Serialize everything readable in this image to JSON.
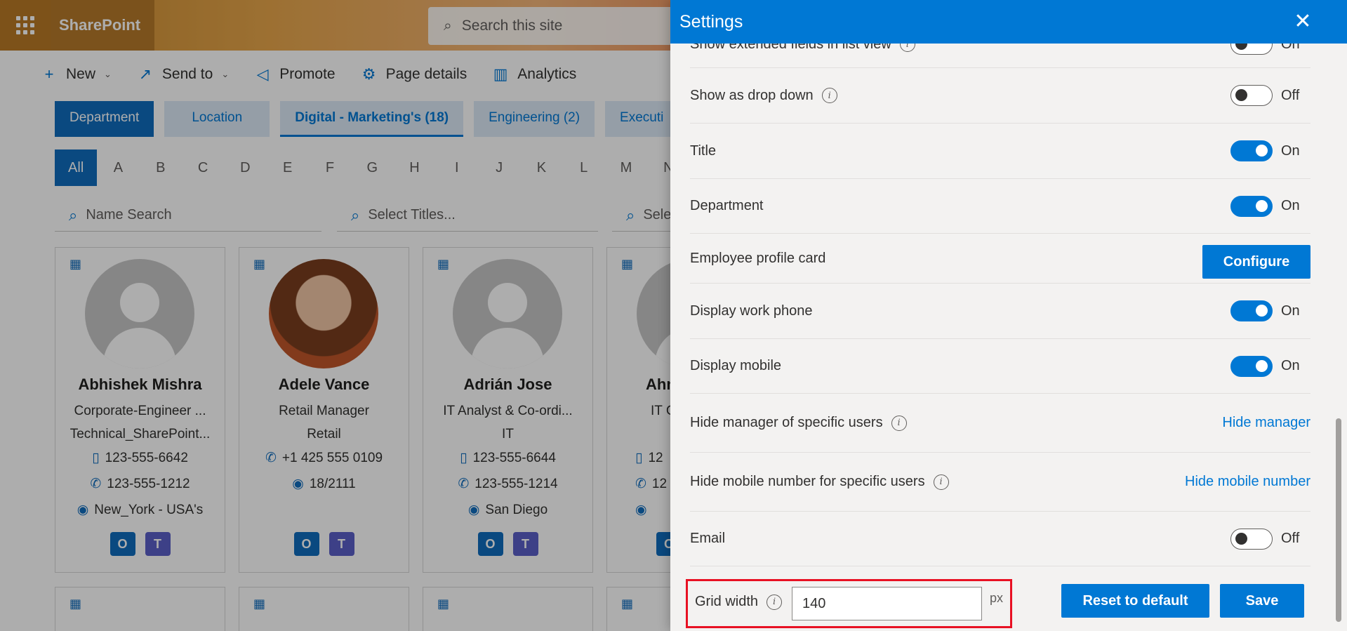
{
  "app": {
    "brand": "SharePoint",
    "search_placeholder": "Search this site"
  },
  "commandbar": {
    "new_label": "New",
    "send_to_label": "Send to",
    "promote_label": "Promote",
    "page_details_label": "Page details",
    "analytics_label": "Analytics"
  },
  "pills": [
    "Department",
    "Location",
    "Digital - Marketing's (18)",
    "Engineering (2)",
    "Executi"
  ],
  "alphabet": [
    "All",
    "A",
    "B",
    "C",
    "D",
    "E",
    "F",
    "G",
    "H",
    "I",
    "J",
    "K",
    "L",
    "M",
    "N"
  ],
  "filters": {
    "name_search": "Name Search",
    "select_titles": "Select Titles...",
    "third": "Sele"
  },
  "people": [
    {
      "name": "Abhishek Mishra",
      "title": "Corporate-Engineer ...",
      "dept": "Technical_SharePoint...",
      "phone1": "123-555-6642",
      "phone2": "123-555-1212",
      "location": "New_York - USA's"
    },
    {
      "name": "Adele Vance",
      "title": "Retail Manager",
      "dept": "Retail",
      "phone1": "+1 425 555 0109",
      "phone2": "",
      "location": "18/2111"
    },
    {
      "name": "Adrián Jose",
      "title": "IT Analyst & Co-ordi...",
      "dept": "IT",
      "phone1": "123-555-6644",
      "phone2": "123-555-1214",
      "location": "San Diego"
    },
    {
      "name": "Ahm",
      "title": "IT C",
      "dept": "",
      "phone1": "12",
      "phone2": "12",
      "location": ""
    }
  ],
  "settings": {
    "title": "Settings",
    "rows": {
      "extended_label": "Show extended fields in list view",
      "extended_state": "On",
      "dropdown_label": "Show as drop down",
      "dropdown_state": "Off",
      "title_label": "Title",
      "title_state": "On",
      "department_label": "Department",
      "department_state": "On",
      "profile_label": "Employee profile card",
      "configure_label": "Configure",
      "work_phone_label": "Display work phone",
      "work_phone_state": "On",
      "mobile_label": "Display mobile",
      "mobile_state": "On",
      "hide_manager_label": "Hide manager of specific users",
      "hide_manager_link": "Hide manager",
      "hide_mobile_label": "Hide mobile number for specific users",
      "hide_mobile_link": "Hide mobile number",
      "email_label": "Email",
      "email_state": "Off"
    },
    "footer": {
      "grid_width_label": "Grid width",
      "grid_width_value": "140",
      "grid_width_unit": "px",
      "reset_label": "Reset to default",
      "save_label": "Save"
    }
  }
}
